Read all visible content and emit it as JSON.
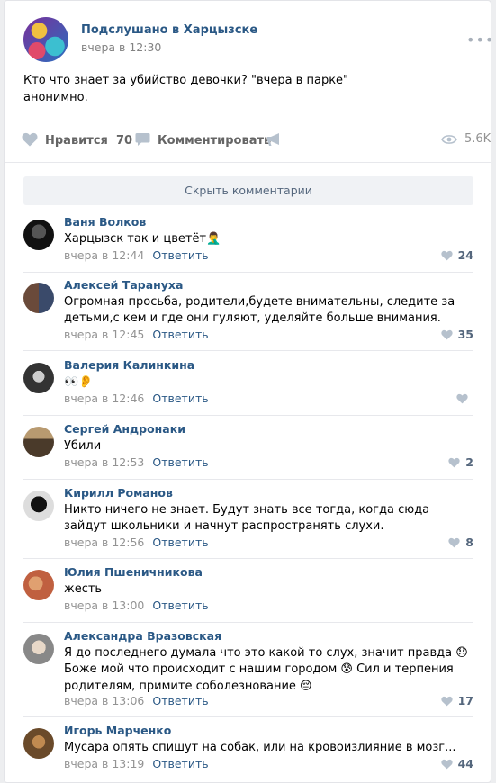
{
  "post": {
    "group_name": "Подслушано в Харцызске",
    "time": "вчера в 12:30",
    "more_glyph": "•••",
    "text": "Кто что знает за убийство девочки? \"вчера в парке\"\nанонимно.",
    "likes_label": "Нравится",
    "likes_count": "70",
    "comment_label": "Комментировать",
    "views": "5.6K",
    "icons": {
      "like": "heart-icon",
      "comment": "speech-bubble-icon",
      "share": "megaphone-icon",
      "views": "eye-icon"
    }
  },
  "hide_comments_label": "Скрыть комментарии",
  "comments": [
    {
      "name": "Ваня Волков",
      "text": "Харцызск так и цветёт🤦‍♂️",
      "time": "вчера в 12:44",
      "reply": "Ответить",
      "likes": "24"
    },
    {
      "name": "Алексей Тарануха",
      "text": "Огромная просьба, родители,будете внимательны, следите за детьми,с кем и где они гуляют, уделяйте больше внимания.",
      "time": "вчера в 12:45",
      "reply": "Ответить",
      "likes": "35"
    },
    {
      "name": "Валерия Калинкина",
      "text": "👀👂",
      "time": "вчера в 12:46",
      "reply": "Ответить",
      "likes": ""
    },
    {
      "name": "Сергей Андронаки",
      "text": "Убили",
      "time": "вчера в 12:53",
      "reply": "Ответить",
      "likes": "2"
    },
    {
      "name": "Кирилл Романов",
      "text": "Никто ничего не знает. Будут знать все тогда, когда сюда зайдут школьники и начнут распространять слухи.",
      "time": "вчера в 12:56",
      "reply": "Ответить",
      "likes": "8"
    },
    {
      "name": "Юлия Пшеничникова",
      "text": "жесть",
      "time": "вчера в 13:00",
      "reply": "Ответить",
      "likes": ""
    },
    {
      "name": "Александра Вразовская",
      "text": "Я до последнего думала что это какой то слух, значит правда 😞 Боже мой что происходит с нашим городом 😰 Сил и терпения родителям, примите соболезнование 😔",
      "time": "вчера в 13:06",
      "reply": "Ответить",
      "likes": "17"
    },
    {
      "name": "Игорь Марченко",
      "text": "Мусара опять спишут на собак, или на кровоизлияние в мозг...",
      "time": "вчера в 13:19",
      "reply": "Ответить",
      "likes": "44"
    }
  ]
}
